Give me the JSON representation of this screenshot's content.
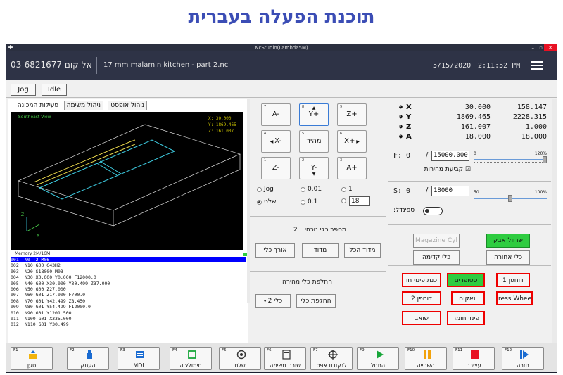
{
  "banner": "תוכנת הפעלה בעברית",
  "window": {
    "title": "NcStudio(Lambda5M)"
  },
  "header": {
    "phone": "03-6821677 אל-קום",
    "file": "17 mm malamin kitchen - part 2.nc",
    "date": "5/15/2020",
    "time": "2:11:52 PM"
  },
  "modebar": {
    "jog": "Jog",
    "idle": "Idle"
  },
  "tabs": [
    "פעילות המכונה",
    "ניהול משימה",
    "ניהול אופסט"
  ],
  "view": {
    "label": "Southeast View",
    "coords": [
      "X:    30.000",
      "Y:  1869.465",
      "Z:   161.007"
    ],
    "memory": "Memory 2M/16M"
  },
  "gcode": [
    {
      "n": "001",
      "t": "N0 T2 M06"
    },
    {
      "n": "002",
      "t": "N10 G00 G43H2"
    },
    {
      "n": "003",
      "t": "N20 S18000 M03"
    },
    {
      "n": "004",
      "t": "N30 X0.000 Y0.000 F12000.0"
    },
    {
      "n": "005",
      "t": "N40 G00 X30.000 Y30.499 Z37.000"
    },
    {
      "n": "006",
      "t": "N50 G00     Z27.000"
    },
    {
      "n": "007",
      "t": "N60 G01     Z17.000 F700.0"
    },
    {
      "n": "008",
      "t": "N70 G01   Y42.499 Z8.450"
    },
    {
      "n": "009",
      "t": "N80 G01   Y54.499  F12000.0"
    },
    {
      "n": "010",
      "t": "N90 G01   Y1201.500"
    },
    {
      "n": "011",
      "t": "N100 G01 X335.000"
    },
    {
      "n": "012",
      "t": "N110 G01   Y30.499"
    }
  ],
  "jog": {
    "keys": [
      {
        "k": "7",
        "l": "A-"
      },
      {
        "k": "8",
        "l": "Y+"
      },
      {
        "k": "9",
        "l": "Z+"
      },
      {
        "k": "4",
        "l": "X-"
      },
      {
        "k": "5",
        "l": "מהיר"
      },
      {
        "k": "6",
        "l": "X+"
      },
      {
        "k": "1",
        "l": "Z-"
      },
      {
        "k": "2",
        "l": "Y-"
      },
      {
        "k": "3",
        "l": "A+"
      }
    ],
    "modes": [
      "Jog",
      "שלט"
    ],
    "steps": [
      "0.01",
      "0.1",
      "1"
    ],
    "step_value": "18"
  },
  "tool": {
    "label": "מספר כלי נוכחי",
    "number": "2",
    "measure_all": "מדוד הכל",
    "measure": "מדוד",
    "length": "אורך כלי"
  },
  "quickchange": {
    "title": "החלפת כלי מהירה",
    "change": "החלפת כלי",
    "select": "כלי 2"
  },
  "axes": [
    {
      "name": "X",
      "v1": "30.000",
      "v2": "158.147"
    },
    {
      "name": "Y",
      "v1": "1869.465",
      "v2": "2228.315"
    },
    {
      "name": "Z",
      "v1": "161.007",
      "v2": "1.000"
    },
    {
      "name": "A",
      "v1": "18.000",
      "v2": "18.000"
    }
  ],
  "feed": {
    "label": "F: 0",
    "value": "15000.000",
    "slider_min": "0",
    "slider_max": "120%",
    "slider_fraction": 1.0,
    "check": "קביעת מהירות"
  },
  "spindle": {
    "label": "S: 0",
    "value": "18000",
    "slider_min": "50",
    "slider_max": "100%",
    "slider_fraction": 0.5,
    "toggle": "ספינדל:"
  },
  "toolbtns": {
    "magazine": "Magazine Cyl",
    "dust": "שרוול אבק",
    "front": "כלי קדימה",
    "back": "כלי אחורה"
  },
  "ioButtons": [
    "כנת פינוי חו",
    "סטופרים",
    "דוחפן 1",
    "Press Whee",
    "וואקום",
    "דוחפן 2",
    "פינוי חומר",
    "שואב"
  ],
  "colors": {
    "header": "#2e3346",
    "banner": "#3b4db5",
    "on": "#2ecc40",
    "off": "#ff0000"
  },
  "fkeys": [
    {
      "k": "F1",
      "l": "טען",
      "icon": "load-icon"
    },
    {
      "k": "F2",
      "l": "העתק",
      "icon": "copy-icon"
    },
    {
      "k": "F3",
      "l": "MDI",
      "icon": "mdi-icon"
    },
    {
      "k": "F4",
      "l": "סימולציה",
      "icon": "simulation-icon"
    },
    {
      "k": "F5",
      "l": "שלט",
      "icon": "remote-icon"
    },
    {
      "k": "F6",
      "l": "שורת משימה",
      "icon": "task-line-icon"
    },
    {
      "k": "F7",
      "l": "לנקודת אפס",
      "icon": "zero-point-icon"
    },
    {
      "k": "F9",
      "l": "התחל",
      "icon": "play-icon"
    },
    {
      "k": "F10",
      "l": "השהייה",
      "icon": "pause-icon"
    },
    {
      "k": "F11",
      "l": "עצירה",
      "icon": "stop-icon"
    },
    {
      "k": "F12",
      "l": "חזרה",
      "icon": "resume-icon"
    }
  ]
}
